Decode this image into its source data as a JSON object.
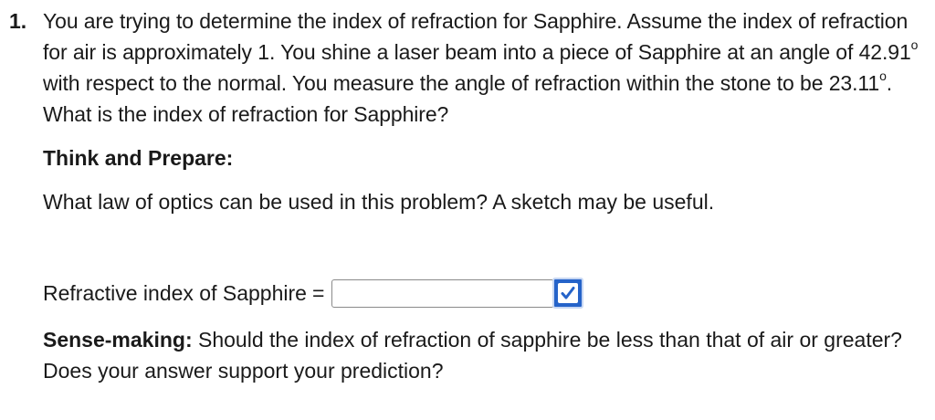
{
  "problem": {
    "number": "1.",
    "q_part1": "You are trying to determine the index of refraction for Sapphire.  Assume the index of refraction for air is approximately 1.  You shine a laser beam into a piece of Sapphire at an angle of ",
    "incident_angle": "42.91",
    "degree_symbol": "o",
    "q_part2": " with respect to the normal.  You measure the angle of refraction within the stone to be ",
    "refraction_angle": "23.11",
    "q_part3": ".  What is the index of refraction for Sapphire?"
  },
  "think": {
    "heading": "Think and Prepare:",
    "prompt": "What law of optics can be used in this problem? A sketch may be useful."
  },
  "answer": {
    "label": "Refractive index of Sapphire",
    "equals": "=",
    "value": ""
  },
  "sense": {
    "label": "Sense-making:",
    "text": " Should the index of refraction of sapphire be less than that of air or greater? Does your answer support your prediction?"
  },
  "icons": {
    "check": "checkmark-icon",
    "accent": "#2563c9"
  }
}
